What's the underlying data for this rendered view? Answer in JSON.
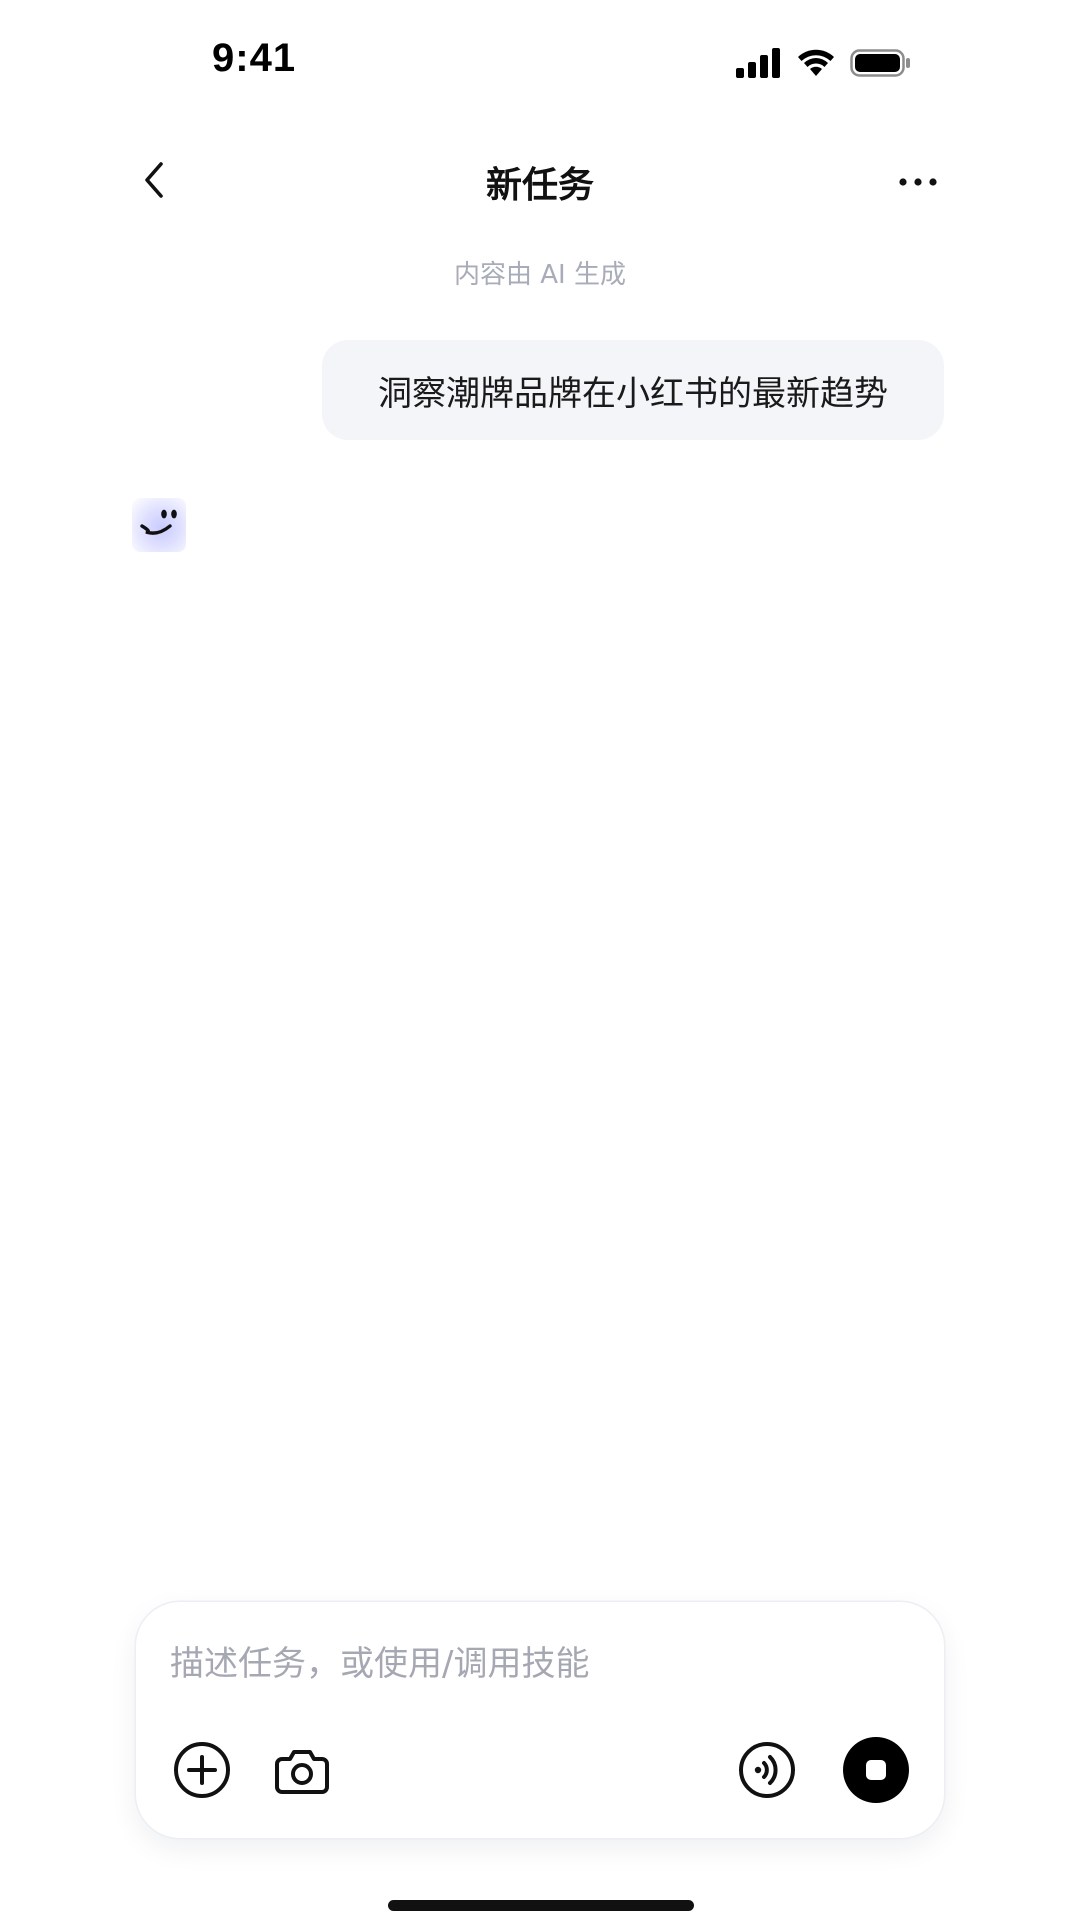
{
  "status_bar": {
    "time": "9:41",
    "icons": [
      "signal-icon",
      "wifi-icon",
      "battery-icon"
    ]
  },
  "nav": {
    "title": "新任务",
    "back_icon": "chevron-left-icon",
    "more_icon": "more-horizontal-icon"
  },
  "disclaimer": "内容由 AI 生成",
  "messages": [
    {
      "role": "user",
      "text": "洞察潮牌品牌在小红书的最新趋势"
    }
  ],
  "assistant": {
    "avatar_icon": "smile-face-icon"
  },
  "composer": {
    "placeholder": "描述任务，或使用/调用技能",
    "value": "",
    "buttons": [
      "plus-circle-icon",
      "camera-icon",
      "voice-icon",
      "stop-icon"
    ]
  },
  "colors": {
    "bubble_bg": "#f4f5f9",
    "muted_text": "#a8acb8",
    "placeholder_text": "#a5a8b2",
    "avatar_accent": "#c9cbff"
  }
}
